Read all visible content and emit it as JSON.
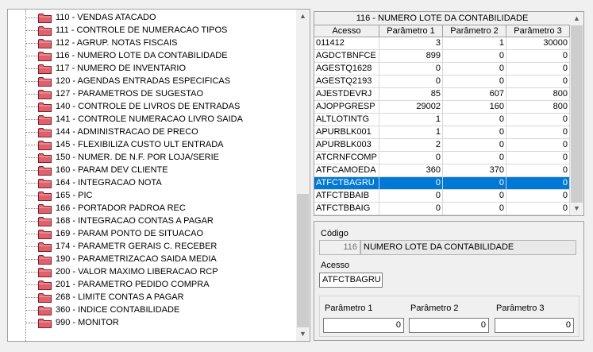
{
  "tree": {
    "items": [
      {
        "label": "110 - VENDAS ATACADO"
      },
      {
        "label": "111 - CONTROLE DE NUMERACAO TIPOS"
      },
      {
        "label": "112 - AGRUP. NOTAS FISCAIS"
      },
      {
        "label": "116 - NUMERO LOTE DA CONTABILIDADE"
      },
      {
        "label": "117 - NUMERO DE INVENTARIO"
      },
      {
        "label": "120 - AGENDAS ENTRADAS ESPECIFICAS"
      },
      {
        "label": "127 - PARAMETROS DE SUGESTAO"
      },
      {
        "label": "140 - CONTROLE DE LIVROS DE ENTRADAS"
      },
      {
        "label": "141 - CONTROLE NUMERACAO LIVRO SAIDA"
      },
      {
        "label": "144 - ADMINISTRACAO DE PRECO"
      },
      {
        "label": "145 - FLEXIBILIZA CUSTO ULT ENTRADA"
      },
      {
        "label": "150 - NUMER. DE N.F. POR LOJA/SERIE"
      },
      {
        "label": "160 - PARAM DEV CLIENTE"
      },
      {
        "label": "164 - INTEGRACAO NOTA"
      },
      {
        "label": "165 - PIC"
      },
      {
        "label": "166 - PORTADOR PADROA REC"
      },
      {
        "label": "168 - INTEGRACAO CONTAS A PAGAR"
      },
      {
        "label": "169 - PARAM PONTO DE SITUACAO"
      },
      {
        "label": "174 - PARAMETR GERAIS C. RECEBER"
      },
      {
        "label": "190 - PARAMETRIZACAO SAIDA MEDIA"
      },
      {
        "label": "200 - VALOR MAXIMO LIBERACAO RCP"
      },
      {
        "label": "201 - PARAMETRO PEDIDO COMPRA"
      },
      {
        "label": "268 - LIMITE CONTAS A PAGAR"
      },
      {
        "label": "360 - INDICE CONTABILIDADE"
      },
      {
        "label": "990 - MONITOR"
      }
    ]
  },
  "grid": {
    "title": "116 - NUMERO LOTE DA CONTABILIDADE",
    "columns": [
      "Acesso",
      "Parâmetro 1",
      "Parâmetro 2",
      "Parâmetro 3"
    ],
    "selected_index": 13,
    "rows": [
      [
        "011412",
        "3",
        "1",
        "30000"
      ],
      [
        "AGDCTBNFCE",
        "899",
        "0",
        "0"
      ],
      [
        "AGESTQ1628",
        "0",
        "0",
        "0"
      ],
      [
        "AGESTQ2193",
        "0",
        "0",
        "0"
      ],
      [
        "AJESTDEVRJ",
        "85",
        "607",
        "800"
      ],
      [
        "AJOPPGRESP",
        "29002",
        "160",
        "800"
      ],
      [
        "ALTLOTINTG",
        "1",
        "0",
        "0"
      ],
      [
        "APURBLK001",
        "1",
        "0",
        "0"
      ],
      [
        "APURBLK003",
        "2",
        "0",
        "0"
      ],
      [
        "ATCRNFCOMP",
        "0",
        "0",
        "0"
      ],
      [
        "ATFCAMOEDA",
        "360",
        "370",
        "0"
      ],
      [
        "ATFCTBAGRU",
        "0",
        "0",
        "0"
      ],
      [
        "ATFCTBBAIB",
        "0",
        "0",
        "0"
      ],
      [
        "ATFCTBBAIG",
        "0",
        "0",
        "0"
      ]
    ]
  },
  "detail": {
    "codigo_label": "Código",
    "codigo_value": "116",
    "descricao_value": "NUMERO LOTE DA CONTABILIDADE",
    "acesso_label": "Acesso",
    "acesso_value": "ATFCTBAGRU",
    "param1_label": "Parâmetro 1",
    "param1_value": "0",
    "param2_label": "Parâmetro 2",
    "param2_value": "0",
    "param3_label": "Parâmetro 3",
    "param3_value": "0"
  },
  "icons": {
    "folder": "folder-icon",
    "scroll_up": "scroll-up-arrow",
    "scroll_down": "scroll-down-arrow"
  },
  "colors": {
    "selection": "#0078d7",
    "folder": "#d94b5a"
  }
}
